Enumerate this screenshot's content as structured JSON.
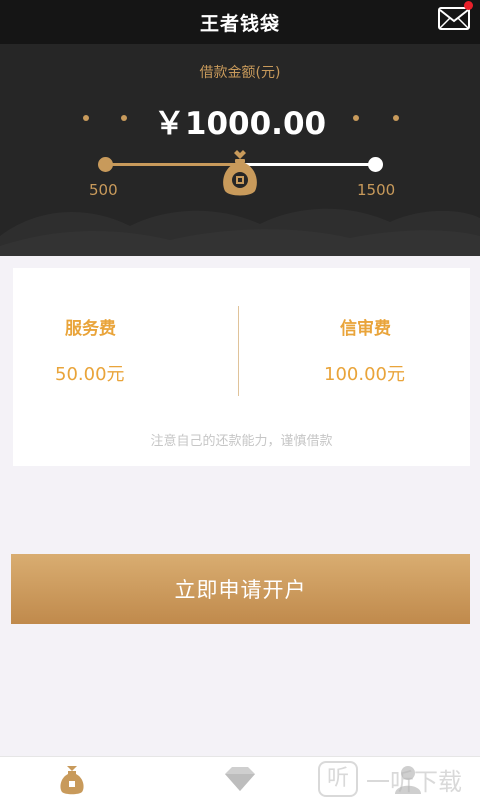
{
  "header": {
    "title": "王者钱袋",
    "mail_icon": "envelope-icon",
    "notification_color": "#e8202a"
  },
  "loan": {
    "label": "借款金额(元)",
    "amount": "￥1000.00",
    "min_label": "500",
    "max_label": "1500",
    "slider_fraction": 0.5,
    "accent": "#c89a5b"
  },
  "fees": {
    "service_label": "服务费",
    "service_value": "50.00元",
    "review_label": "信审费",
    "review_value": "100.00元",
    "note": "注意自己的还款能力，谨慎借款"
  },
  "cta": {
    "label": "立即申请开户"
  },
  "tabbar": {
    "tabs": [
      {
        "icon": "money-bag-icon",
        "active": true
      },
      {
        "icon": "diamond-icon",
        "active": false
      },
      {
        "icon": "user-icon",
        "active": false
      }
    ]
  },
  "watermark": {
    "badge": "听",
    "text": "一听下载"
  }
}
